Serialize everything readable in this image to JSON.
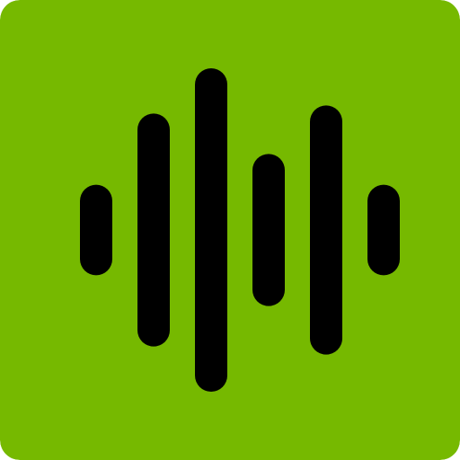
{
  "icon": {
    "name": "audio-waveform-icon",
    "background_color": "#76b900",
    "bar_color": "#000000",
    "bars": [
      {
        "level": 0.28
      },
      {
        "level": 0.72
      },
      {
        "level": 1.0
      },
      {
        "level": 0.47
      },
      {
        "level": 0.77
      },
      {
        "level": 0.28
      }
    ]
  }
}
